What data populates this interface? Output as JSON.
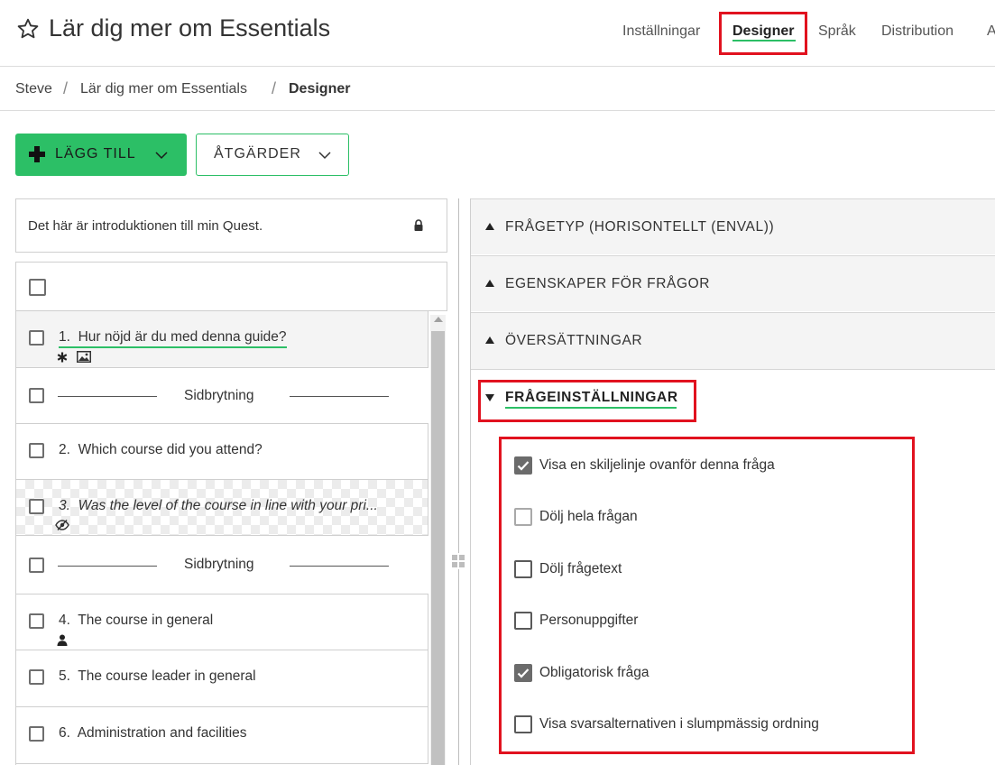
{
  "header": {
    "title": "Lär dig mer om Essentials",
    "tabs": {
      "settings": "Inställningar",
      "designer": "Designer",
      "language": "Språk",
      "distribution": "Distribution",
      "more": "A"
    }
  },
  "breadcrumb": {
    "steve": "Steve",
    "survey": "Lär dig mer om Essentials",
    "current": "Designer",
    "separator": "/"
  },
  "toolbar": {
    "add_label": "LÄGG TILL",
    "actions_label": "ÅTGÄRDER"
  },
  "intro": {
    "text": "Det här är introduktionen till min Quest."
  },
  "questions": {
    "q1": {
      "number": "1.",
      "text": "Hur nöjd är du med denna guide?"
    },
    "pagebreak1": "Sidbrytning",
    "q2": {
      "number": "2.",
      "text": "Which course did you attend?"
    },
    "q3": {
      "number": "3.",
      "text": "Was the level of the course in line with your pri..."
    },
    "pagebreak2": "Sidbrytning",
    "q4": {
      "number": "4.",
      "text": "The course in general"
    },
    "q5": {
      "number": "5.",
      "text": "The course leader in general"
    },
    "q6": {
      "number": "6.",
      "text": "Administration and facilities"
    }
  },
  "right_panel": {
    "sections": {
      "question_type": "FRÅGETYP (HORISONTELLT (ENVAL))",
      "question_properties": "EGENSKAPER FÖR FRÅGOR",
      "translations": "ÖVERSÄTTNINGAR",
      "question_settings": "FRÅGEINSTÄLLNINGAR"
    },
    "options": {
      "separator_above": {
        "label": "Visa en skiljelinje ovanför denna fråga",
        "checked": true
      },
      "hide_question": {
        "label": "Dölj hela frågan",
        "checked": false
      },
      "hide_question_text": {
        "label": "Dölj frågetext",
        "checked": false
      },
      "personal_data": {
        "label": "Personuppgifter",
        "checked": false
      },
      "mandatory": {
        "label": "Obligatorisk fråga",
        "checked": true
      },
      "randomize_answers": {
        "label": "Visa svarsalternativen i slumpmässig ordning",
        "checked": false
      }
    }
  },
  "colors": {
    "accent_green": "#2cbf66",
    "highlight_red": "#e1121f"
  }
}
